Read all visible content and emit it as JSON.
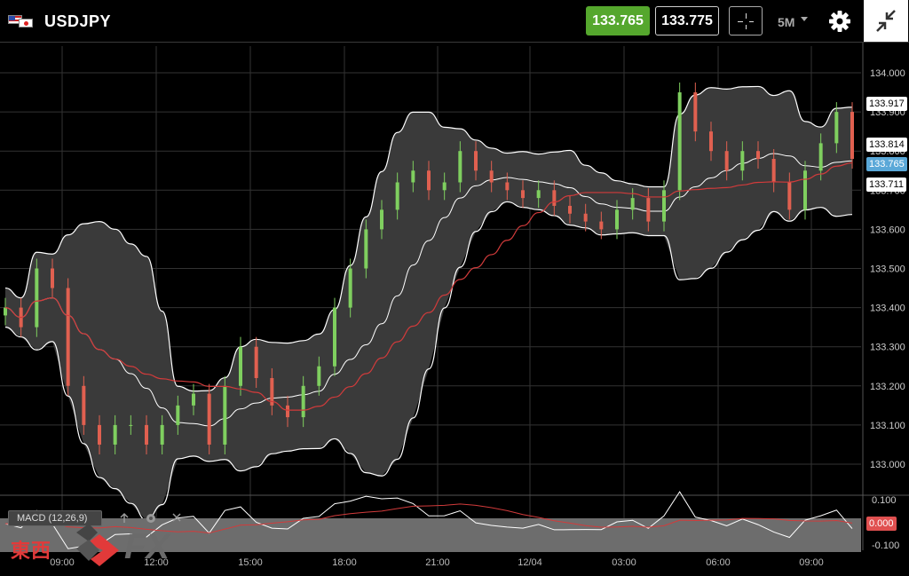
{
  "header": {
    "symbol": "USDJPY",
    "bid_price": "133.765",
    "ask_price": "133.775",
    "timeframe": "5M",
    "icons": [
      "us-flag-icon",
      "jp-flag-icon",
      "crosshair-icon",
      "gear-icon",
      "collapse-icon"
    ]
  },
  "colors": {
    "bid_button": "#55a72d",
    "bollinger_band": "#ffffff",
    "band_fill": "#3a3a3a",
    "moving_average": "#d23b3b",
    "candle_up": "#7fcf5f",
    "candle_down": "#e06050",
    "last_price_tag": "#5aa8d8",
    "macd_line": "#ffffff",
    "macd_signal": "#d23b3b"
  },
  "price_axis": {
    "labels": [
      "134.000",
      "133.900",
      "133.800",
      "133.700",
      "133.600",
      "133.500",
      "133.400",
      "133.300",
      "133.200",
      "133.100",
      "133.000"
    ],
    "tags": {
      "upper_band": "133.917",
      "middle_band": "133.814",
      "last_price": "133.765",
      "lower_band": "133.711"
    }
  },
  "macd": {
    "label": "MACD (12,26,9)",
    "axis_labels": [
      "0.100",
      "0.000",
      "-0.100"
    ],
    "value_tag": "0.000"
  },
  "time_axis": {
    "labels": [
      "09:00",
      "12:00",
      "15:00",
      "18:00",
      "21:00",
      "12/04",
      "03:00",
      "06:00",
      "09:00"
    ]
  },
  "chart_data": {
    "type": "line",
    "description_series": "USDJPY 5-minute candles with Bollinger Bands and MACD",
    "ylim": [
      132.95,
      134.05
    ],
    "series": [
      {
        "name": "close",
        "values": [
          133.4,
          133.35,
          133.5,
          133.45,
          133.2,
          133.1,
          133.05,
          133.1,
          133.1,
          133.05,
          133.1,
          133.15,
          133.18,
          133.05,
          133.2,
          133.3,
          133.22,
          133.15,
          133.12,
          133.2,
          133.25,
          133.4,
          133.5,
          133.6,
          133.65,
          133.72,
          133.75,
          133.7,
          133.72,
          133.8,
          133.75,
          133.72,
          133.7,
          133.68,
          133.7,
          133.66,
          133.64,
          133.62,
          133.6,
          133.65,
          133.68,
          133.62,
          133.7,
          133.95,
          133.85,
          133.8,
          133.75,
          133.8,
          133.78,
          133.72,
          133.65,
          133.75,
          133.82,
          133.9,
          133.78
        ]
      }
    ],
    "time_labels": [
      "09:00",
      "12:00",
      "15:00",
      "18:00",
      "21:00",
      "12/04",
      "03:00",
      "06:00",
      "09:00"
    ]
  },
  "branding": {
    "logo_kanji": "東西",
    "logo_fx": "FX"
  }
}
